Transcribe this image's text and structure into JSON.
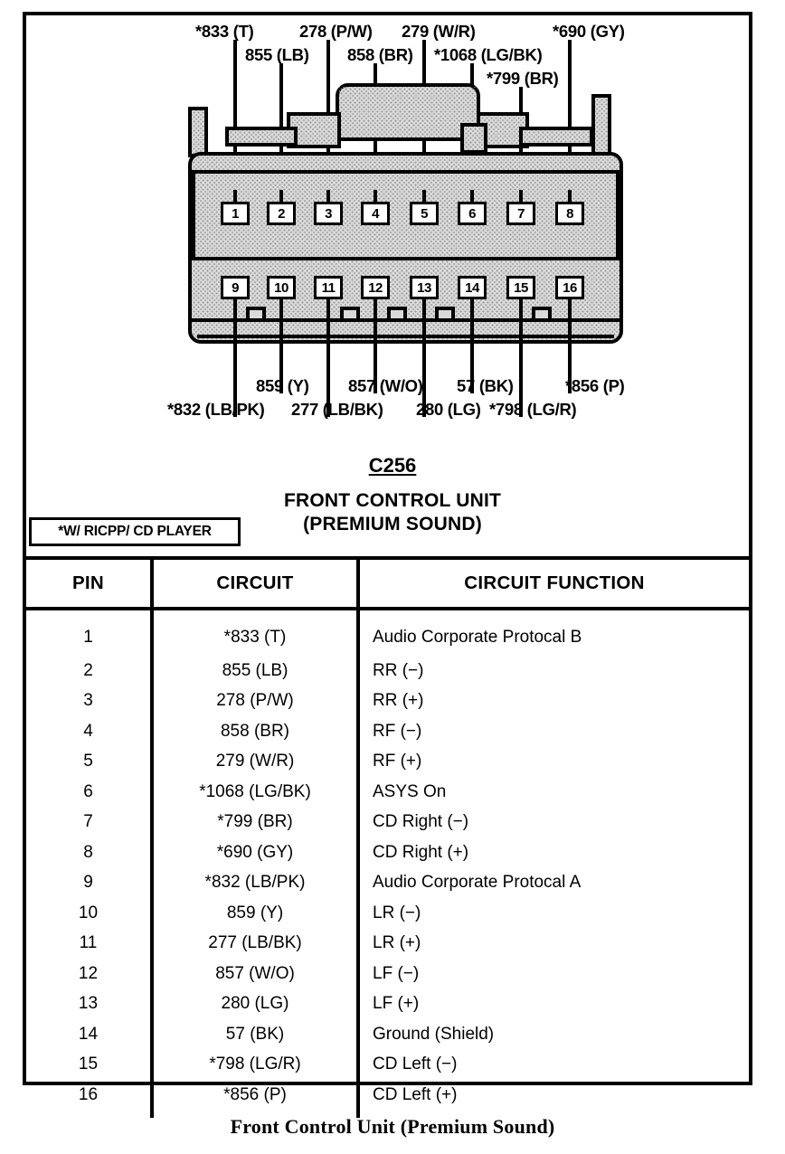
{
  "diagram": {
    "connector_id": "C256",
    "unit_title_line1": "FRONT CONTROL UNIT",
    "unit_title_line2": "(PREMIUM SOUND)",
    "footnote": "*W/ RICPP/ CD PLAYER",
    "caption": "Front Control Unit (Premium Sound)",
    "top_labels": [
      {
        "text": "*833 (T)",
        "pin": 1
      },
      {
        "text": "855 (LB)",
        "pin": 2
      },
      {
        "text": "278 (P/W)",
        "pin": 3
      },
      {
        "text": "858 (BR)",
        "pin": 4
      },
      {
        "text": "279 (W/R)",
        "pin": 5
      },
      {
        "text": "*1068 (LG/BK)",
        "pin": 6
      },
      {
        "text": "*799 (BR)",
        "pin": 7
      },
      {
        "text": "*690 (GY)",
        "pin": 8
      }
    ],
    "bottom_labels": [
      {
        "text": "*832 (LB/PK)",
        "pin": 9
      },
      {
        "text": "859 (Y)",
        "pin": 10
      },
      {
        "text": "277 (LB/BK)",
        "pin": 11
      },
      {
        "text": "857 (W/O)",
        "pin": 12
      },
      {
        "text": "280 (LG)",
        "pin": 13
      },
      {
        "text": "57 (BK)",
        "pin": 14
      },
      {
        "text": "*798 (LG/R)",
        "pin": 15
      },
      {
        "text": "*856 (P)",
        "pin": 16
      }
    ],
    "pin_numbers_top": [
      "1",
      "2",
      "3",
      "4",
      "5",
      "6",
      "7",
      "8"
    ],
    "pin_numbers_bottom": [
      "9",
      "10",
      "11",
      "12",
      "13",
      "14",
      "15",
      "16"
    ]
  },
  "table": {
    "headers": [
      "PIN",
      "CIRCUIT",
      "CIRCUIT FUNCTION"
    ],
    "rows": [
      {
        "pin": "1",
        "circuit": "*833 (T)",
        "function": "Audio Corporate Protocal B"
      },
      {
        "pin": "2",
        "circuit": "855 (LB)",
        "function": "RR (−)"
      },
      {
        "pin": "3",
        "circuit": "278 (P/W)",
        "function": "RR (+)"
      },
      {
        "pin": "4",
        "circuit": "858 (BR)",
        "function": "RF (−)"
      },
      {
        "pin": "5",
        "circuit": "279 (W/R)",
        "function": "RF (+)"
      },
      {
        "pin": "6",
        "circuit": "*1068 (LG/BK)",
        "function": "ASYS On"
      },
      {
        "pin": "7",
        "circuit": "*799 (BR)",
        "function": "CD Right (−)"
      },
      {
        "pin": "8",
        "circuit": "*690 (GY)",
        "function": "CD Right (+)"
      },
      {
        "pin": "9",
        "circuit": "*832 (LB/PK)",
        "function": "Audio Corporate Protocal A"
      },
      {
        "pin": "10",
        "circuit": "859 (Y)",
        "function": "LR (−)"
      },
      {
        "pin": "11",
        "circuit": "277 (LB/BK)",
        "function": "LR (+)"
      },
      {
        "pin": "12",
        "circuit": "857 (W/O)",
        "function": "LF (−)"
      },
      {
        "pin": "13",
        "circuit": "280 (LG)",
        "function": "LF (+)"
      },
      {
        "pin": "14",
        "circuit": "57 (BK)",
        "function": "Ground (Shield)"
      },
      {
        "pin": "15",
        "circuit": "*798 (LG/R)",
        "function": "CD Left (−)"
      },
      {
        "pin": "16",
        "circuit": "*856 (P)",
        "function": "CD Left (+)"
      }
    ]
  },
  "colors": {
    "ink": "#000000",
    "paper": "#ffffff",
    "connector_fill": "#d9d9d9"
  }
}
